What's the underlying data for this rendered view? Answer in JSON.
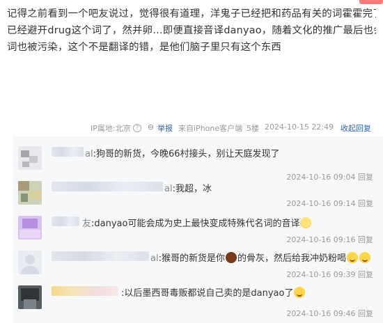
{
  "post": {
    "lines": [
      "记得之前看到一个吧友说过，觉得很有道理，洋鬼子已经把和药品有关的词霍霍完了，这次",
      "已经避开drug这个词了，然并卵…即便直接音译danyao，随着文化的推广最后也会导致这个",
      "词也被污染，这个不是翻译的错，是他们脑子里只有这个东西"
    ]
  },
  "meta": {
    "ip": "IP属地:北京",
    "help_icon": "?",
    "report": "举报",
    "client": "来自iPhone客户端",
    "floor": "5楼",
    "datetime": "2024-10-15 22:49",
    "toggle_reply": "收起回复"
  },
  "comments": [
    {
      "sep": "al",
      "text": ":狗哥的新货，今晚66村接头，别让天庭发现了",
      "time": "2024-10-16 09:04",
      "reply": "回复"
    },
    {
      "sep": "al",
      "text": ":我超，冰",
      "time": "2024-10-16 09:14",
      "reply": "回复"
    },
    {
      "sep": "友",
      "text": ":danyao可能会成为史上最快变成特殊代名词的音译",
      "time": "2024-10-16 09:16",
      "reply": "回复"
    },
    {
      "sep": "al",
      "text_a": ":猴哥的新货是你",
      "text_b": "的骨灰，然后给我冲奶粉喝",
      "time": "2024-10-16 09:39",
      "reply": "回复"
    },
    {
      "sep": "",
      "text": ":以后墨西哥毒贩都说自己卖的是danyao了",
      "time": "2024-10-16 09:46",
      "reply": "回复"
    }
  ],
  "icons": [
    "help-icon",
    "report-icon",
    "smile-emoji",
    "monkey-emoji",
    "wave-emoji"
  ]
}
